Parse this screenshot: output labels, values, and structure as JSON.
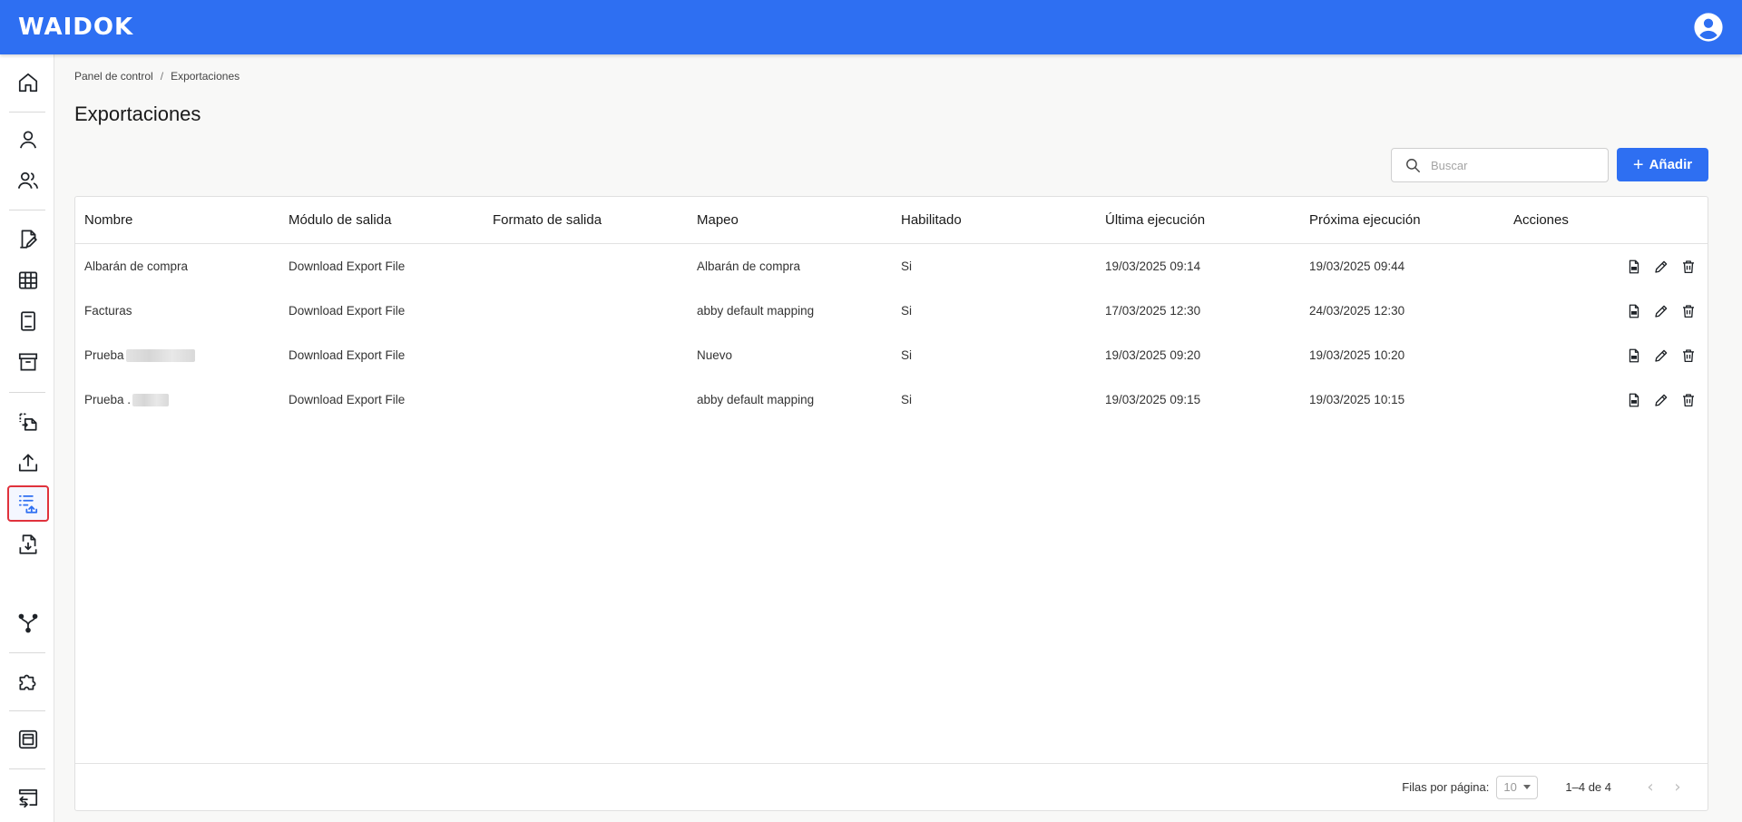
{
  "app": {
    "logo_text": "WAIDOK",
    "brand_color": "#2e6ff2"
  },
  "header": {
    "profile_icon": "account-circle-icon"
  },
  "sidebar": {
    "items": [
      {
        "name": "home",
        "icon": "home-icon"
      },
      {
        "name": "user",
        "icon": "user-icon"
      },
      {
        "name": "users",
        "icon": "users-icon"
      },
      {
        "name": "document-edit",
        "icon": "document-edit-icon"
      },
      {
        "name": "table",
        "icon": "table-icon"
      },
      {
        "name": "book",
        "icon": "book-icon"
      },
      {
        "name": "archive",
        "icon": "archive-icon"
      },
      {
        "name": "file-transfer",
        "icon": "file-transfer-icon"
      },
      {
        "name": "upload",
        "icon": "upload-icon"
      },
      {
        "name": "exports",
        "icon": "list-upload-icon",
        "active": true
      },
      {
        "name": "file-download",
        "icon": "file-download-icon"
      },
      {
        "name": "workflow",
        "icon": "branch-icon"
      },
      {
        "name": "plugins",
        "icon": "puzzle-icon"
      },
      {
        "name": "panel",
        "icon": "layout-icon"
      },
      {
        "name": "terminal",
        "icon": "window-swap-icon"
      }
    ]
  },
  "breadcrumb": {
    "root": "Panel de control",
    "separator": "/",
    "current": "Exportaciones"
  },
  "page": {
    "title": "Exportaciones"
  },
  "search": {
    "placeholder": "Buscar",
    "value": ""
  },
  "toolbar": {
    "add_label": "Añadir",
    "add_symbol": "+"
  },
  "table": {
    "columns": [
      "Nombre",
      "Módulo de salida",
      "Formato de salida",
      "Mapeo",
      "Habilitado",
      "Última ejecución",
      "Próxima ejecución",
      "Acciones"
    ],
    "rows": [
      {
        "nombre": "Albarán de compra",
        "modulo": "Download Export File",
        "formato": "",
        "mapeo": "Albarán de compra",
        "habilitado": "Si",
        "ultima": "19/03/2025 09:14",
        "proxima": "19/03/2025 09:44"
      },
      {
        "nombre": "Facturas",
        "modulo": "Download Export File",
        "formato": "",
        "mapeo": "abby default mapping",
        "habilitado": "Si",
        "ultima": "17/03/2025 12:30",
        "proxima": "24/03/2025 12:30"
      },
      {
        "nombre": "Prueba",
        "modulo": "Download Export File",
        "formato": "",
        "mapeo": "Nuevo",
        "habilitado": "Si",
        "ultima": "19/03/2025 09:20",
        "proxima": "19/03/2025 10:20"
      },
      {
        "nombre": "Prueba .",
        "modulo": "Download Export File",
        "formato": "",
        "mapeo": "abby default mapping",
        "habilitado": "Si",
        "ultima": "19/03/2025 09:15",
        "proxima": "19/03/2025 10:15"
      }
    ],
    "row_actions": [
      "export-file-icon",
      "edit-icon",
      "trash-icon"
    ]
  },
  "pagination": {
    "rows_label": "Filas por página:",
    "rows_value": "10",
    "range": "1–4 de 4"
  }
}
